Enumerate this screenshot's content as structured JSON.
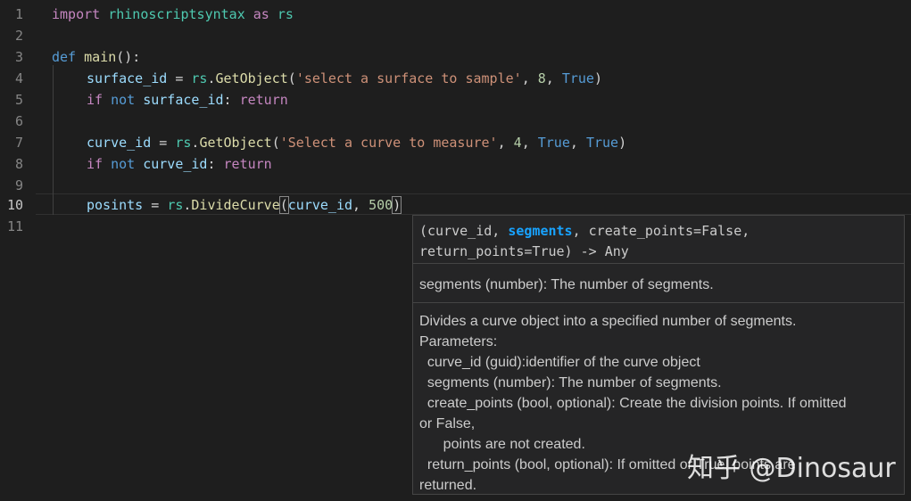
{
  "line_numbers": [
    "1",
    "2",
    "3",
    "4",
    "5",
    "6",
    "7",
    "8",
    "9",
    "10",
    "11"
  ],
  "code": {
    "line1": {
      "import": "import",
      "module": "rhinoscriptsyntax",
      "as": "as",
      "alias": "rs"
    },
    "line3": {
      "def": "def",
      "name": "main",
      "rest": "():"
    },
    "line4": {
      "var": "surface_id",
      "eq": " = ",
      "obj": "rs",
      "dot": ".",
      "fn": "GetObject",
      "open": "(",
      "str": "'select a surface to sample'",
      "c1": ", ",
      "num": "8",
      "c2": ", ",
      "bool": "True",
      "close": ")"
    },
    "line5": {
      "if": "if",
      "not": "not",
      "var": "surface_id",
      "colon": ": ",
      "ret": "return"
    },
    "line7": {
      "var": "curve_id",
      "eq": " = ",
      "obj": "rs",
      "dot": ".",
      "fn": "GetObject",
      "open": "(",
      "str": "'Select a curve to measure'",
      "c1": ", ",
      "num": "4",
      "c2": ", ",
      "bool1": "True",
      "c3": ", ",
      "bool2": "True",
      "close": ")"
    },
    "line8": {
      "if": "if",
      "not": "not",
      "var": "curve_id",
      "colon": ": ",
      "ret": "return"
    },
    "line10": {
      "var": "posints",
      "eq": " = ",
      "obj": "rs",
      "dot": ".",
      "fn": "DivideCurve",
      "open": "(",
      "arg": "curve_id",
      "c1": ", ",
      "num": "500",
      "close": ")"
    }
  },
  "hover": {
    "sig_pre": "(curve_id, ",
    "sig_active": "segments",
    "sig_post": ", create_points=False,",
    "sig_line2": "return_points=True) -> Any",
    "param_doc": "segments (number): The number of segments.",
    "desc_lines": [
      "Divides a curve object into a specified number of segments.",
      "Parameters:",
      "  curve_id (guid):identifier of the curve object",
      "  segments (number): The number of segments.",
      "  create_points (bool, optional): Create the division points. If omitted",
      "or False,",
      "      points are not created.",
      "  return_points (bool, optional): If omitted or True, points are",
      "returned."
    ]
  },
  "watermark": "知乎 @Dinosaur"
}
